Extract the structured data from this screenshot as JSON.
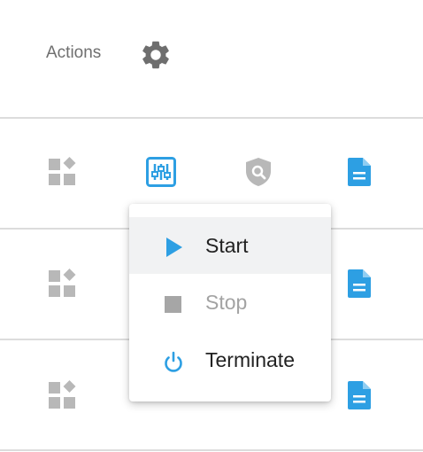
{
  "header": {
    "title": "Actions",
    "settings_icon": "gear-icon"
  },
  "colors": {
    "accent": "#2d9fe3",
    "icon_gray": "#b8b8b8",
    "dark_gray": "#6e6e6e"
  },
  "rows": [
    {
      "icons": [
        "widgets-icon",
        "tune-icon",
        "security-search-icon",
        "document-icon"
      ]
    },
    {
      "icons": [
        "widgets-icon",
        "document-icon"
      ]
    },
    {
      "icons": [
        "widgets-icon",
        "document-icon"
      ]
    }
  ],
  "menu": {
    "items": [
      {
        "label": "Start",
        "icon": "play-icon",
        "state": "hovered"
      },
      {
        "label": "Stop",
        "icon": "stop-icon",
        "state": "disabled"
      },
      {
        "label": "Terminate",
        "icon": "power-icon",
        "state": "enabled"
      }
    ]
  }
}
